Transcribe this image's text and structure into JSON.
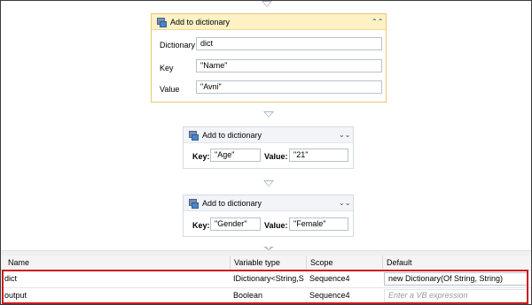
{
  "activities": [
    {
      "title": "Add to dictionary",
      "collapse_icon": "chevron-up-double-icon",
      "fields": [
        {
          "label": "Dictionary",
          "value": "dict"
        },
        {
          "label": "Key",
          "value": "\"Name\""
        },
        {
          "label": "Value",
          "value": "\"Avni\""
        }
      ]
    },
    {
      "title": "Add to dictionary",
      "collapse_icon": "chevron-down-double-icon",
      "key_label": "Key:",
      "key_value": "\"Age\"",
      "value_label": "Value:",
      "value_value": "\"21\""
    },
    {
      "title": "Add to dictionary",
      "collapse_icon": "chevron-down-double-icon",
      "key_label": "Key:",
      "key_value": "\"Gender\"",
      "value_label": "Value:",
      "value_value": "\"Female\""
    }
  ],
  "variables_panel": {
    "headers": {
      "name": "Name",
      "type": "Variable type",
      "scope": "Scope",
      "default": "Default"
    },
    "rows": [
      {
        "name": "dict",
        "type": "IDictionary<String,S",
        "scope": "Sequence4",
        "default": "new Dictionary(Of String, String)"
      },
      {
        "name": "output",
        "type": "Boolean",
        "scope": "Sequence4",
        "default": "Enter a VB expression"
      }
    ]
  },
  "colors": {
    "selected_border": "#e8c873",
    "highlight": "#cc1a1a"
  }
}
